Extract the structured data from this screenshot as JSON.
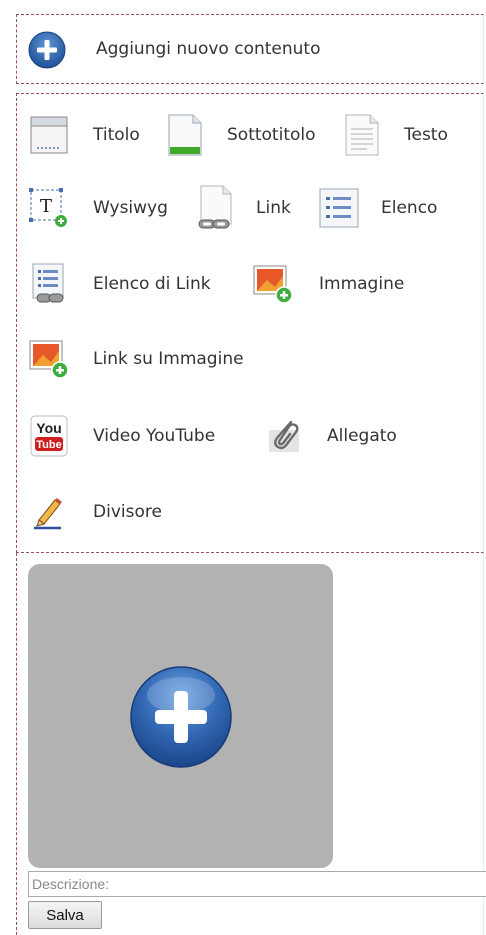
{
  "add_content": {
    "label": "Aggiungi nuovo contenuto",
    "icon": "plus-circle-icon"
  },
  "tools": [
    {
      "label": "Titolo",
      "icon": "title-block-icon"
    },
    {
      "label": "Sottotitolo",
      "icon": "subtitle-page-icon"
    },
    {
      "label": "Testo",
      "icon": "text-page-icon"
    },
    {
      "label": "Wysiwyg",
      "icon": "wysiwyg-icon"
    },
    {
      "label": "Link",
      "icon": "link-page-icon"
    },
    {
      "label": "Elenco",
      "icon": "list-icon"
    },
    {
      "label": "Elenco di Link",
      "icon": "link-list-icon"
    },
    {
      "label": "Immagine",
      "icon": "image-add-icon"
    },
    {
      "label": "Link su Immagine",
      "icon": "image-link-icon"
    },
    {
      "label": "Video YouTube",
      "icon": "youtube-icon"
    },
    {
      "label": "Allegato",
      "icon": "paperclip-icon"
    },
    {
      "label": "Divisore",
      "icon": "pencil-icon"
    }
  ],
  "youtube_badge": {
    "line1": "You",
    "line2": "Tube"
  },
  "upload": {
    "icon": "plus-circle-icon"
  },
  "description": {
    "placeholder": "Descrizione:",
    "value": ""
  },
  "save_button": {
    "label": "Salva"
  },
  "colors": {
    "dashed_border": "#9a4f5a",
    "upload_bg": "#b2b2b2",
    "plus_blue": "#2c5fa8",
    "youtube_red": "#cc2020",
    "image_orange": "#e8572a",
    "add_green": "#3fae3f"
  }
}
